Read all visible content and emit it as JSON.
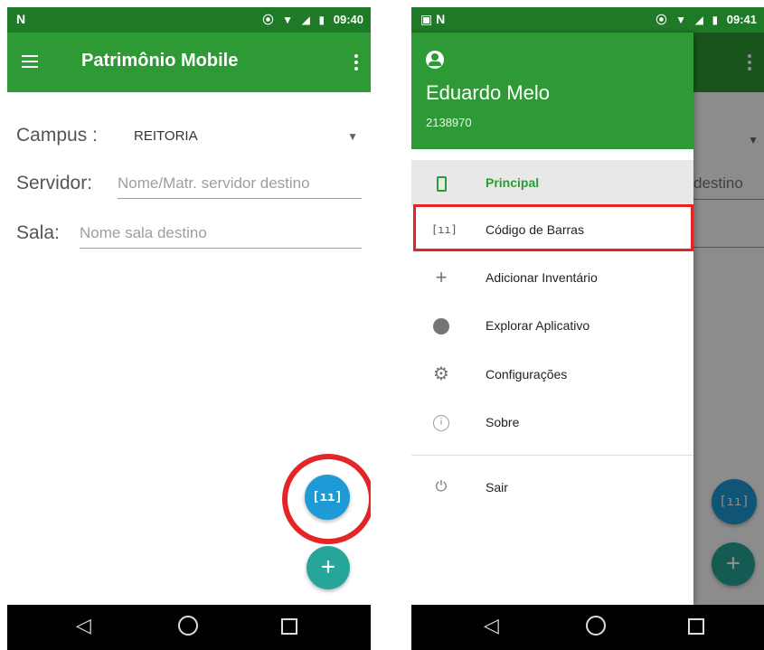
{
  "colors": {
    "appbar": "#2e9a36",
    "statusbar": "#1f7a27",
    "fab_scan": "#1e9bd7",
    "fab_add": "#26a69a",
    "highlight": "#e32525",
    "active_item": "#2e9a36"
  },
  "screen1": {
    "statusbar": {
      "left_icon": "N",
      "time": "09:40"
    },
    "appbar": {
      "title": "Patrimônio Mobile",
      "menu_icon": "hamburger-menu-icon",
      "overflow_icon": "more-vert-icon"
    },
    "form": {
      "campus": {
        "label": "Campus :",
        "value": "REITORIA"
      },
      "servidor": {
        "label": "Servidor:",
        "placeholder": "Nome/Matr. servidor destino"
      },
      "sala": {
        "label": "Sala:",
        "placeholder": "Nome sala destino"
      }
    },
    "fabs": {
      "scan_icon": "barcode-scan-icon",
      "add_label": "+"
    }
  },
  "screen2": {
    "statusbar": {
      "time": "09:41"
    },
    "drawer": {
      "user_name": "Eduardo Melo",
      "user_id": "2138970",
      "items": [
        {
          "label": "Principal",
          "icon": "phone-icon",
          "active": true
        },
        {
          "label": "Código de Barras",
          "icon": "barcode-icon",
          "highlighted": true
        },
        {
          "label": "Adicionar Inventário",
          "icon": "plus-icon"
        },
        {
          "label": "Explorar Aplicativo",
          "icon": "compass-icon"
        },
        {
          "label": "Configurações",
          "icon": "gear-icon"
        },
        {
          "label": "Sobre",
          "icon": "info-icon"
        },
        {
          "label": "Sair",
          "icon": "power-icon"
        }
      ]
    },
    "background_fragment": "destino"
  },
  "navbar": {
    "back": "◁",
    "home": "○",
    "recent": "□"
  }
}
